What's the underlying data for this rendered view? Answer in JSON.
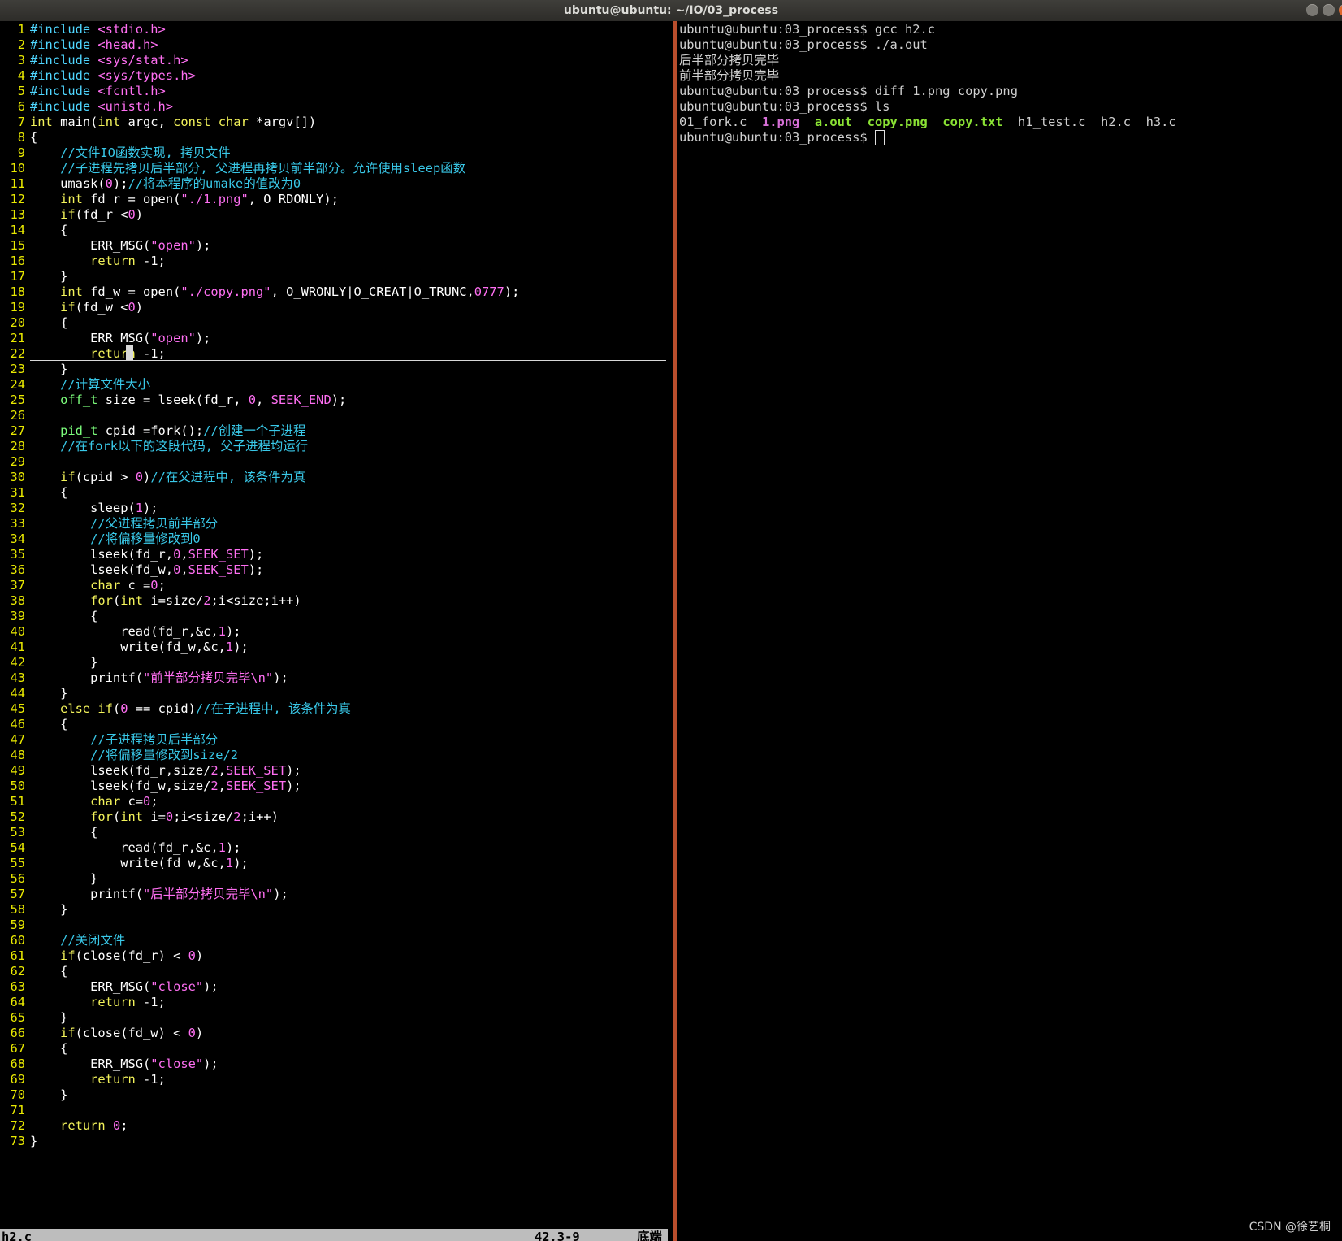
{
  "window": {
    "title": "ubuntu@ubuntu: ~/IO/03_process"
  },
  "colors": {
    "background": "#000000",
    "text": "#ffffff",
    "line_number": "#e9e900",
    "preprocessor": "#4fd6ff",
    "keyword": "#f2f25a",
    "comment": "#39c8e8",
    "string": "#ff6ff2",
    "number": "#ff6ff2",
    "type": "#7dff7d",
    "divider": "#b84d2c",
    "statusline_bg": "#bdbdbd"
  },
  "editor": {
    "lines": [
      [
        [
          "pp",
          "#include "
        ],
        [
          "str",
          "<stdio.h>"
        ]
      ],
      [
        [
          "pp",
          "#include "
        ],
        [
          "str",
          "<head.h>"
        ]
      ],
      [
        [
          "pp",
          "#include "
        ],
        [
          "str",
          "<sys/stat.h>"
        ]
      ],
      [
        [
          "pp",
          "#include "
        ],
        [
          "str",
          "<sys/types.h>"
        ]
      ],
      [
        [
          "pp",
          "#include "
        ],
        [
          "str",
          "<fcntl.h>"
        ]
      ],
      [
        [
          "pp",
          "#include "
        ],
        [
          "str",
          "<unistd.h>"
        ]
      ],
      [
        [
          "kw",
          "int"
        ],
        [
          "n",
          " main("
        ],
        [
          "kw",
          "int"
        ],
        [
          "n",
          " argc, "
        ],
        [
          "kw",
          "const char"
        ],
        [
          "n",
          " *argv[])"
        ]
      ],
      [
        [
          "n",
          "{"
        ]
      ],
      [
        [
          "n",
          "    "
        ],
        [
          "cm",
          "//文件IO函数实现, 拷贝文件"
        ]
      ],
      [
        [
          "n",
          "    "
        ],
        [
          "cm",
          "//子进程先拷贝后半部分, 父进程再拷贝前半部分。允许使用sleep函数"
        ]
      ],
      [
        [
          "n",
          "    umask("
        ],
        [
          "num",
          "0"
        ],
        [
          "n",
          ");"
        ],
        [
          "cm",
          "//将本程序的umake的值改为0"
        ]
      ],
      [
        [
          "n",
          "    "
        ],
        [
          "kw",
          "int"
        ],
        [
          "n",
          " fd_r = open("
        ],
        [
          "str",
          "\"./1.png\""
        ],
        [
          "n",
          ", O_RDONLY);"
        ]
      ],
      [
        [
          "n",
          "    "
        ],
        [
          "kw",
          "if"
        ],
        [
          "n",
          "(fd_r <"
        ],
        [
          "num",
          "0"
        ],
        [
          "n",
          ")"
        ]
      ],
      [
        [
          "n",
          "    {"
        ]
      ],
      [
        [
          "n",
          "        ERR_MSG("
        ],
        [
          "str",
          "\"open\""
        ],
        [
          "n",
          ");"
        ]
      ],
      [
        [
          "n",
          "        "
        ],
        [
          "kw",
          "return"
        ],
        [
          "n",
          " -1;"
        ]
      ],
      [
        [
          "n",
          "    }"
        ]
      ],
      [
        [
          "n",
          "    "
        ],
        [
          "kw",
          "int"
        ],
        [
          "n",
          " fd_w = open("
        ],
        [
          "str",
          "\"./copy.png\""
        ],
        [
          "n",
          ", O_WRONLY|O_CREAT|O_TRUNC,"
        ],
        [
          "num",
          "0777"
        ],
        [
          "n",
          ");"
        ]
      ],
      [
        [
          "n",
          "    "
        ],
        [
          "kw",
          "if"
        ],
        [
          "n",
          "(fd_w <"
        ],
        [
          "num",
          "0"
        ],
        [
          "n",
          ")"
        ]
      ],
      [
        [
          "n",
          "    {"
        ]
      ],
      [
        [
          "n",
          "        ERR_MSG("
        ],
        [
          "str",
          "\"open\""
        ],
        [
          "n",
          ");"
        ]
      ],
      [
        [
          "n",
          "        "
        ],
        [
          "kw",
          "return"
        ],
        [
          "n",
          " -1;"
        ]
      ],
      [
        [
          "n",
          "    }"
        ]
      ],
      [
        [
          "n",
          "    "
        ],
        [
          "cm",
          "//计算文件大小"
        ]
      ],
      [
        [
          "n",
          "    "
        ],
        [
          "ty",
          "off_t"
        ],
        [
          "n",
          " size = lseek(fd_r, "
        ],
        [
          "num",
          "0"
        ],
        [
          "n",
          ", "
        ],
        [
          "str",
          "SEEK_END"
        ],
        [
          "n",
          ");"
        ]
      ],
      [
        [
          "n",
          ""
        ]
      ],
      [
        [
          "n",
          "    "
        ],
        [
          "ty",
          "pid_t"
        ],
        [
          "n",
          " cpid =fork();"
        ],
        [
          "cm",
          "//创建一个子进程"
        ]
      ],
      [
        [
          "n",
          "    "
        ],
        [
          "cm",
          "//在fork以下的这段代码, 父子进程均运行"
        ]
      ],
      [
        [
          "n",
          ""
        ]
      ],
      [
        [
          "n",
          "    "
        ],
        [
          "kw",
          "if"
        ],
        [
          "n",
          "(cpid > "
        ],
        [
          "num",
          "0"
        ],
        [
          "n",
          ")"
        ],
        [
          "cm",
          "//在父进程中, 该条件为真"
        ]
      ],
      [
        [
          "n",
          "    {"
        ]
      ],
      [
        [
          "n",
          "        sleep("
        ],
        [
          "num",
          "1"
        ],
        [
          "n",
          ");"
        ]
      ],
      [
        [
          "n",
          "        "
        ],
        [
          "cm",
          "//父进程拷贝前半部分"
        ]
      ],
      [
        [
          "n",
          "        "
        ],
        [
          "cm",
          "//将偏移量修改到0"
        ]
      ],
      [
        [
          "n",
          "        lseek(fd_r,"
        ],
        [
          "num",
          "0"
        ],
        [
          "n",
          ","
        ],
        [
          "str",
          "SEEK_SET"
        ],
        [
          "n",
          ");"
        ]
      ],
      [
        [
          "n",
          "        lseek(fd_w,"
        ],
        [
          "num",
          "0"
        ],
        [
          "n",
          ","
        ],
        [
          "str",
          "SEEK_SET"
        ],
        [
          "n",
          ");"
        ]
      ],
      [
        [
          "n",
          "        "
        ],
        [
          "kw",
          "char"
        ],
        [
          "n",
          " c ="
        ],
        [
          "num",
          "0"
        ],
        [
          "n",
          ";"
        ]
      ],
      [
        [
          "n",
          "        "
        ],
        [
          "kw",
          "for"
        ],
        [
          "n",
          "("
        ],
        [
          "kw",
          "int"
        ],
        [
          "n",
          " i=size/"
        ],
        [
          "num",
          "2"
        ],
        [
          "n",
          ";i<size;i++)"
        ]
      ],
      [
        [
          "n",
          "        {"
        ]
      ],
      [
        [
          "n",
          "            read(fd_r,&c,"
        ],
        [
          "num",
          "1"
        ],
        [
          "n",
          ");"
        ]
      ],
      [
        [
          "n",
          "            write(fd_w,&c,"
        ],
        [
          "num",
          "1"
        ],
        [
          "n",
          ");"
        ]
      ],
      [
        [
          "n",
          "        }"
        ]
      ],
      [
        [
          "n",
          "        printf("
        ],
        [
          "str",
          "\"前半部分拷贝完毕\\n\""
        ],
        [
          "n",
          ");"
        ]
      ],
      [
        [
          "n",
          "    }"
        ]
      ],
      [
        [
          "n",
          "    "
        ],
        [
          "kw",
          "else if"
        ],
        [
          "n",
          "("
        ],
        [
          "num",
          "0"
        ],
        [
          "n",
          " == cpid)"
        ],
        [
          "cm",
          "//在子进程中, 该条件为真"
        ]
      ],
      [
        [
          "n",
          "    {"
        ]
      ],
      [
        [
          "n",
          "        "
        ],
        [
          "cm",
          "//子进程拷贝后半部分"
        ]
      ],
      [
        [
          "n",
          "        "
        ],
        [
          "cm",
          "//将偏移量修改到size/2"
        ]
      ],
      [
        [
          "n",
          "        lseek(fd_r,size/"
        ],
        [
          "num",
          "2"
        ],
        [
          "n",
          ","
        ],
        [
          "str",
          "SEEK_SET"
        ],
        [
          "n",
          ");"
        ]
      ],
      [
        [
          "n",
          "        lseek(fd_w,size/"
        ],
        [
          "num",
          "2"
        ],
        [
          "n",
          ","
        ],
        [
          "str",
          "SEEK_SET"
        ],
        [
          "n",
          ");"
        ]
      ],
      [
        [
          "n",
          "        "
        ],
        [
          "kw",
          "char"
        ],
        [
          "n",
          " c="
        ],
        [
          "num",
          "0"
        ],
        [
          "n",
          ";"
        ]
      ],
      [
        [
          "n",
          "        "
        ],
        [
          "kw",
          "for"
        ],
        [
          "n",
          "("
        ],
        [
          "kw",
          "int"
        ],
        [
          "n",
          " i="
        ],
        [
          "num",
          "0"
        ],
        [
          "n",
          ";i<size/"
        ],
        [
          "num",
          "2"
        ],
        [
          "n",
          ";i++)"
        ]
      ],
      [
        [
          "n",
          "        {"
        ]
      ],
      [
        [
          "n",
          "            read(fd_r,&c,"
        ],
        [
          "num",
          "1"
        ],
        [
          "n",
          ");"
        ]
      ],
      [
        [
          "n",
          "            write(fd_w,&c,"
        ],
        [
          "num",
          "1"
        ],
        [
          "n",
          ");"
        ]
      ],
      [
        [
          "n",
          "        }"
        ]
      ],
      [
        [
          "n",
          "        printf("
        ],
        [
          "str",
          "\"后半部分拷贝完毕\\n\""
        ],
        [
          "n",
          ");"
        ]
      ],
      [
        [
          "n",
          "    }"
        ]
      ],
      [
        [
          "n",
          ""
        ]
      ],
      [
        [
          "n",
          "    "
        ],
        [
          "cm",
          "//关闭文件"
        ]
      ],
      [
        [
          "n",
          "    "
        ],
        [
          "kw",
          "if"
        ],
        [
          "n",
          "(close(fd_r) < "
        ],
        [
          "num",
          "0"
        ],
        [
          "n",
          ")"
        ]
      ],
      [
        [
          "n",
          "    {"
        ]
      ],
      [
        [
          "n",
          "        ERR_MSG("
        ],
        [
          "str",
          "\"close\""
        ],
        [
          "n",
          ");"
        ]
      ],
      [
        [
          "n",
          "        "
        ],
        [
          "kw",
          "return"
        ],
        [
          "n",
          " -1;"
        ]
      ],
      [
        [
          "n",
          "    }"
        ]
      ],
      [
        [
          "n",
          "    "
        ],
        [
          "kw",
          "if"
        ],
        [
          "n",
          "(close(fd_w) < "
        ],
        [
          "num",
          "0"
        ],
        [
          "n",
          ")"
        ]
      ],
      [
        [
          "n",
          "    {"
        ]
      ],
      [
        [
          "n",
          "        ERR_MSG("
        ],
        [
          "str",
          "\"close\""
        ],
        [
          "n",
          ");"
        ]
      ],
      [
        [
          "n",
          "        "
        ],
        [
          "kw",
          "return"
        ],
        [
          "n",
          " -1;"
        ]
      ],
      [
        [
          "n",
          "    }"
        ]
      ],
      [
        [
          "n",
          ""
        ]
      ],
      [
        [
          "n",
          "    "
        ],
        [
          "kw",
          "return"
        ],
        [
          "n",
          " "
        ],
        [
          "num",
          "0"
        ],
        [
          "n",
          ";"
        ]
      ],
      [
        [
          "n",
          "}"
        ]
      ]
    ],
    "cursor_line": 21,
    "status": {
      "filename": "h2.c",
      "position": "42,3-9",
      "mode": "底端"
    }
  },
  "terminal": {
    "lines": [
      "ubuntu@ubuntu:03_process$ gcc h2.c",
      "ubuntu@ubuntu:03_process$ ./a.out",
      "后半部分拷贝完毕",
      "前半部分拷贝完毕",
      "ubuntu@ubuntu:03_process$ diff 1.png copy.png",
      "ubuntu@ubuntu:03_process$ ls"
    ],
    "ls_output": [
      {
        "name": "01_fork.c",
        "style": "plain"
      },
      {
        "name": "1.png",
        "style": "image"
      },
      {
        "name": "a.out",
        "style": "exec"
      },
      {
        "name": "copy.png",
        "style": "exec"
      },
      {
        "name": "copy.txt",
        "style": "exec"
      },
      {
        "name": "h1_test.c",
        "style": "plain"
      },
      {
        "name": "h2.c",
        "style": "plain"
      },
      {
        "name": "h3.c",
        "style": "plain"
      }
    ],
    "ls_colors": {
      "plain": "#d0d0d0",
      "image": "#d66fd6",
      "exec": "#8ae234"
    },
    "prompt": "ubuntu@ubuntu:03_process$ "
  },
  "watermark": "CSDN @徐艺桐"
}
